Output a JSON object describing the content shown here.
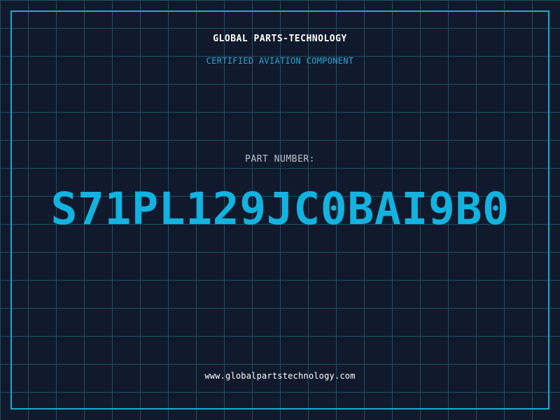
{
  "company": {
    "name": "GLOBAL PARTS-TECHNOLOGY",
    "tagline": "CERTIFIED AVIATION COMPONENT",
    "website": "www.globalpartstechnology.com"
  },
  "part": {
    "label": "PART NUMBER:",
    "number": "S71PL129JC0BAI9B0"
  },
  "colors": {
    "background": "#101a2c",
    "grid": "#1d4e63",
    "frame": "#1aa9cf",
    "accent": "#12b3e0",
    "tagline": "#26a8d6",
    "label": "#b9c3cf",
    "text": "#ffffff"
  }
}
